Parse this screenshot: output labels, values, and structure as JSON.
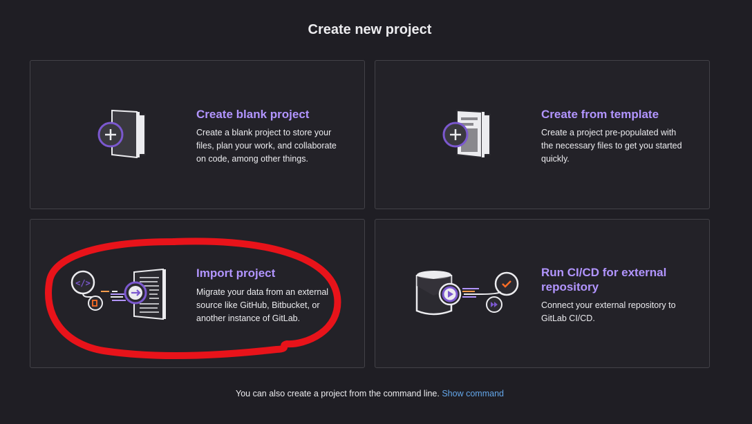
{
  "page": {
    "title": "Create new project"
  },
  "cards": [
    {
      "title": "Create blank project",
      "description": "Create a blank project to store your files, plan your work, and collaborate on code, among other things.",
      "icon": "blank-project-illustration"
    },
    {
      "title": "Create from template",
      "description": "Create a project pre-populated with the necessary files to get you started quickly.",
      "icon": "template-project-illustration"
    },
    {
      "title": "Import project",
      "description": "Migrate your data from an external source like GitHub, Bitbucket, or another instance of GitLab.",
      "icon": "import-project-illustration"
    },
    {
      "title": "Run CI/CD for external repository",
      "description": "Connect your external repository to GitLab CI/CD.",
      "icon": "ci-cd-illustration"
    }
  ],
  "footer": {
    "text": "You can also create a project from the command line.",
    "link": "Show command"
  },
  "colors": {
    "background": "#1f1e24",
    "card_border": "#434248",
    "accent_purple": "#b295ff",
    "link_blue": "#63a6e9",
    "annotation_red": "#e8131a"
  }
}
